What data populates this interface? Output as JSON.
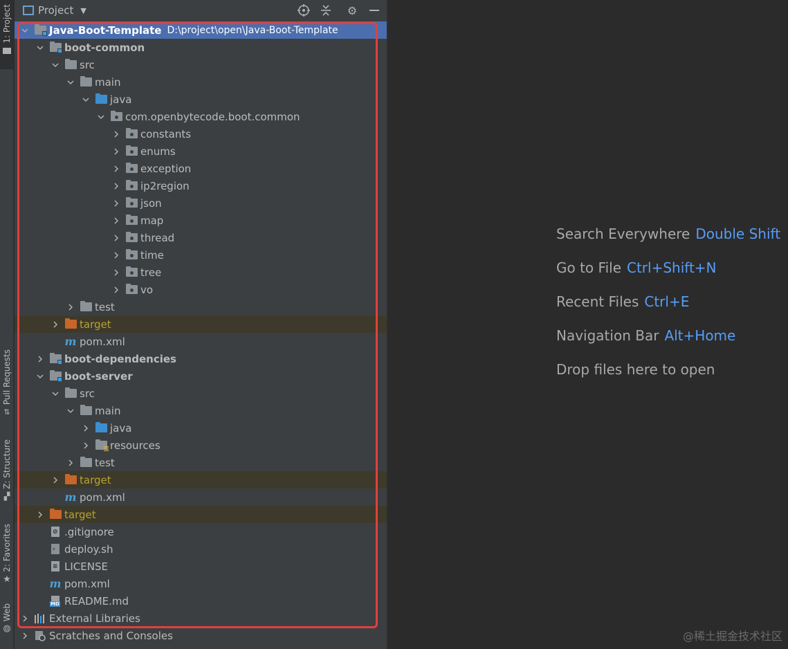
{
  "stripe": {
    "project": "1: Project",
    "pull_requests": "Pull Requests",
    "structure": "Z: Structure",
    "favorites": "2: Favorites",
    "web": "Web"
  },
  "panel": {
    "title": "Project"
  },
  "tree": [
    {
      "indent": 0,
      "arrow": "down",
      "icon": "module-folder",
      "label": "Java-Boot-Template",
      "path": "D:\\project\\open\\Java-Boot-Template",
      "bold": true,
      "selected": true
    },
    {
      "indent": 1,
      "arrow": "down",
      "icon": "module-folder",
      "label": "boot-common",
      "bold": true
    },
    {
      "indent": 2,
      "arrow": "down",
      "icon": "folder",
      "label": "src"
    },
    {
      "indent": 3,
      "arrow": "down",
      "icon": "folder",
      "label": "main"
    },
    {
      "indent": 4,
      "arrow": "down",
      "icon": "source-folder",
      "label": "java"
    },
    {
      "indent": 5,
      "arrow": "down",
      "icon": "package",
      "label": "com.openbytecode.boot.common"
    },
    {
      "indent": 6,
      "arrow": "right",
      "icon": "package",
      "label": "constants"
    },
    {
      "indent": 6,
      "arrow": "right",
      "icon": "package",
      "label": "enums"
    },
    {
      "indent": 6,
      "arrow": "right",
      "icon": "package",
      "label": "exception"
    },
    {
      "indent": 6,
      "arrow": "right",
      "icon": "package",
      "label": "ip2region"
    },
    {
      "indent": 6,
      "arrow": "right",
      "icon": "package",
      "label": "json"
    },
    {
      "indent": 6,
      "arrow": "right",
      "icon": "package",
      "label": "map"
    },
    {
      "indent": 6,
      "arrow": "right",
      "icon": "package",
      "label": "thread"
    },
    {
      "indent": 6,
      "arrow": "right",
      "icon": "package",
      "label": "time"
    },
    {
      "indent": 6,
      "arrow": "right",
      "icon": "package",
      "label": "tree"
    },
    {
      "indent": 6,
      "arrow": "right",
      "icon": "package",
      "label": "vo"
    },
    {
      "indent": 3,
      "arrow": "right",
      "icon": "folder",
      "label": "test"
    },
    {
      "indent": 2,
      "arrow": "right",
      "icon": "excluded-folder",
      "label": "target",
      "excluded": true
    },
    {
      "indent": 2,
      "arrow": "none",
      "icon": "maven",
      "label": "pom.xml"
    },
    {
      "indent": 1,
      "arrow": "right",
      "icon": "module-folder",
      "label": "boot-dependencies",
      "bold": true
    },
    {
      "indent": 1,
      "arrow": "down",
      "icon": "module-folder",
      "label": "boot-server",
      "bold": true
    },
    {
      "indent": 2,
      "arrow": "down",
      "icon": "folder",
      "label": "src"
    },
    {
      "indent": 3,
      "arrow": "down",
      "icon": "folder",
      "label": "main"
    },
    {
      "indent": 4,
      "arrow": "right",
      "icon": "source-folder",
      "label": "java"
    },
    {
      "indent": 4,
      "arrow": "right",
      "icon": "resources-folder",
      "label": "resources"
    },
    {
      "indent": 3,
      "arrow": "right",
      "icon": "folder",
      "label": "test"
    },
    {
      "indent": 2,
      "arrow": "right",
      "icon": "excluded-folder",
      "label": "target",
      "excluded": true
    },
    {
      "indent": 2,
      "arrow": "none",
      "icon": "maven",
      "label": "pom.xml"
    },
    {
      "indent": 1,
      "arrow": "right",
      "icon": "excluded-folder",
      "label": "target",
      "excluded": true
    },
    {
      "indent": 1,
      "arrow": "none",
      "icon": "gitignore-file",
      "label": ".gitignore"
    },
    {
      "indent": 1,
      "arrow": "none",
      "icon": "shell-file",
      "label": "deploy.sh"
    },
    {
      "indent": 1,
      "arrow": "none",
      "icon": "text-file",
      "label": "LICENSE"
    },
    {
      "indent": 1,
      "arrow": "none",
      "icon": "maven",
      "label": "pom.xml"
    },
    {
      "indent": 1,
      "arrow": "none",
      "icon": "markdown-file",
      "label": "README.md"
    },
    {
      "indent": 0,
      "arrow": "right",
      "icon": "libraries",
      "label": "External Libraries"
    },
    {
      "indent": 0,
      "arrow": "right",
      "icon": "scratches",
      "label": "Scratches and Consoles"
    }
  ],
  "editor": {
    "hints": [
      {
        "text": "Search Everywhere",
        "key": "Double Shift"
      },
      {
        "text": "Go to File",
        "key": "Ctrl+Shift+N"
      },
      {
        "text": "Recent Files",
        "key": "Ctrl+E"
      },
      {
        "text": "Navigation Bar",
        "key": "Alt+Home"
      },
      {
        "text": "Drop files here to open",
        "key": ""
      }
    ],
    "watermark": "@稀土掘金技术社区"
  },
  "colors": {
    "selection": "#4b6eaf",
    "highlight_box": "#e0413e",
    "shortcut": "#589df6",
    "excluded_text": "#b8a232"
  }
}
